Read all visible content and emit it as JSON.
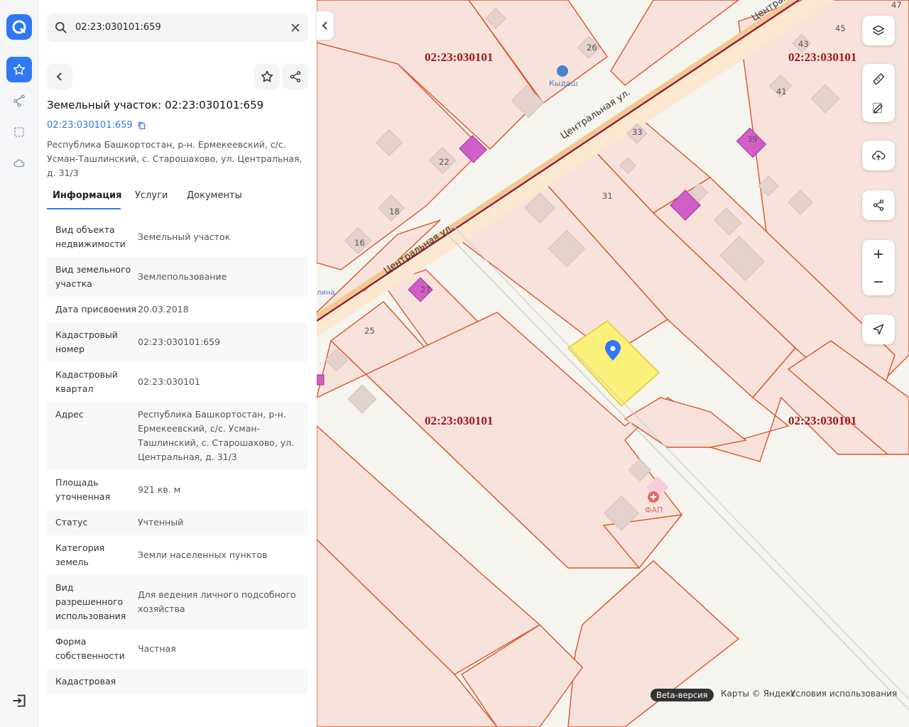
{
  "rail": {
    "icons": [
      "logo-icon",
      "star-icon",
      "route-icon",
      "selection-icon",
      "cloud-icon",
      "logout-icon"
    ]
  },
  "search": {
    "value": "02:23:030101:659"
  },
  "card": {
    "title": "Земельный участок: 02:23:030101:659",
    "cad_link": "02:23:030101:659",
    "address": "Республика Башкортостан, р-н. Ермекеевский, с/с. Усман-Ташлинский, с. Старошахово, ул. Центральная, д. 31/3"
  },
  "tabs": [
    {
      "label": "Информация",
      "active": true
    },
    {
      "label": "Услуги",
      "active": false
    },
    {
      "label": "Документы",
      "active": false
    }
  ],
  "info_rows": [
    {
      "key": "Вид объекта недвижимости",
      "value": "Земельный участок"
    },
    {
      "key": "Вид земельного участка",
      "value": "Землепользование"
    },
    {
      "key": "Дата присвоения",
      "value": "20.03.2018"
    },
    {
      "key": "Кадастровый номер",
      "value": "02:23:030101:659"
    },
    {
      "key": "Кадастровый квартал",
      "value": "02:23:030101"
    },
    {
      "key": "Адрес",
      "value": "Республика Башкортостан, р-н. Ермекеевский, с/с. Усман-Ташлинский, с. Старошахово, ул. Центральная, д. 31/3"
    },
    {
      "key": "Площадь уточненная",
      "value": "921 кв. м"
    },
    {
      "key": "Статус",
      "value": "Учтенный"
    },
    {
      "key": "Категория земель",
      "value": "Земли населенных пунктов"
    },
    {
      "key": "Вид разрешенного использования",
      "value": "Для ведения личного подсобного хозяйства"
    },
    {
      "key": "Форма собственности",
      "value": "Частная"
    },
    {
      "key": "Кадастровая",
      "value": ""
    }
  ],
  "map": {
    "quarter_label": "02:23:030101",
    "street": "Центральная ул.",
    "house_numbers": [
      "26",
      "22",
      "18",
      "16",
      "27",
      "25",
      "33",
      "31",
      "39",
      "41",
      "43",
      "45",
      "47"
    ],
    "poi": [
      "Кыдаш",
      "ФАП",
      "лина"
    ],
    "colors": {
      "parcel_fill": "#f8e3dc",
      "parcel_stroke": "#e0522a",
      "selected": "#fbf07a",
      "building_pink": "#d25fc8",
      "building_grey": "#e4d2cc",
      "quarter_text": "#a3151b",
      "marker": "#2f78f4"
    },
    "beta": "Beta-версия",
    "attribution": "Карты © Яндекс",
    "terms": "Условия использования"
  },
  "map_controls": [
    "layers-icon",
    "ruler-icon",
    "edit-icon",
    "upload-icon",
    "share-icon",
    "zoom-in-icon",
    "zoom-out-icon",
    "locate-icon"
  ]
}
